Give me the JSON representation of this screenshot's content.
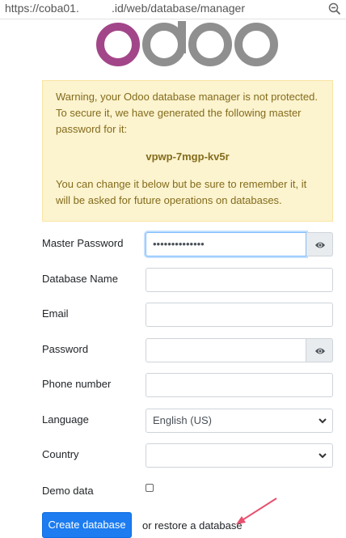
{
  "browser": {
    "url_prefix": "https://coba01.",
    "url_suffix": ".id/web/database/manager",
    "zoom_icon": "zoom-out-icon"
  },
  "logo": {
    "alt": "odoo"
  },
  "alert": {
    "line1": "Warning, your Odoo database manager is not protected. To secure it, we have generated the following master password for it:",
    "master_password": "vpwp-7mgp-kv5r",
    "line2": "You can change it below but be sure to remember it, it will be asked for future operations on databases."
  },
  "form": {
    "master_password_label": "Master Password",
    "master_password_value": "••••••••••••••",
    "database_name_label": "Database Name",
    "email_label": "Email",
    "password_label": "Password",
    "phone_label": "Phone number",
    "language_label": "Language",
    "language_value": "English (US)",
    "country_label": "Country",
    "country_value": "",
    "demo_data_label": "Demo data"
  },
  "actions": {
    "create_button": "Create database",
    "or_text": "or ",
    "restore_link": "restore a database"
  },
  "colors": {
    "primary": "#1c7cf0",
    "odoo_purple": "#a24689",
    "odoo_gray": "#8f8f8f",
    "alert_bg": "#fcf3cf",
    "alert_text": "#836c1c",
    "annotation_arrow": "#e8506e"
  }
}
